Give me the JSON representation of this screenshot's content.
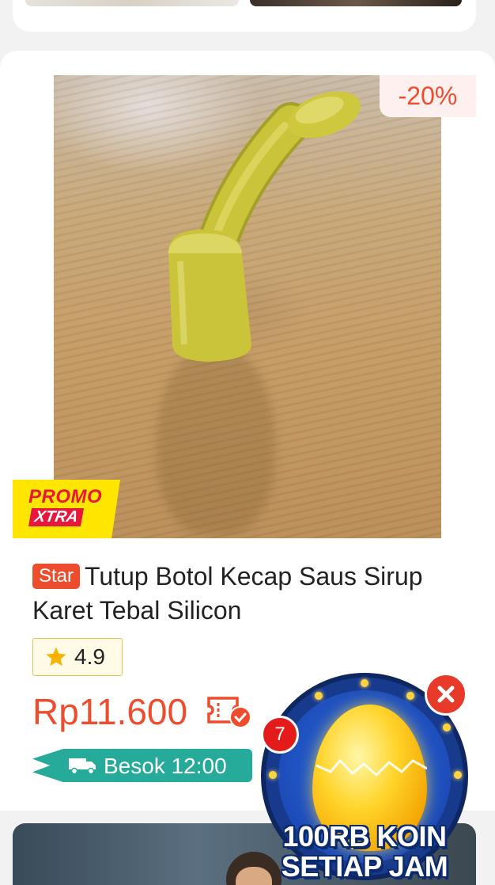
{
  "product": {
    "discount": "-20%",
    "promo_line1": "PROMO",
    "promo_line2": "XTRA",
    "star_badge": "Star",
    "title": "Tutup Botol Kecap Saus Sirup Karet Tebal Silicon",
    "rating": "4.9",
    "price": "Rp11.600",
    "delivery": "Besok 12:00"
  },
  "popup": {
    "count": "7",
    "line1": "100RB KOIN",
    "line2": "SETIAP JAM"
  },
  "colors": {
    "accent": "#ee4d2d",
    "delivery": "#26aa99",
    "rating_border": "#e5c050"
  },
  "icons": [
    "star-icon",
    "voucher-icon",
    "truck-icon",
    "close-icon"
  ]
}
